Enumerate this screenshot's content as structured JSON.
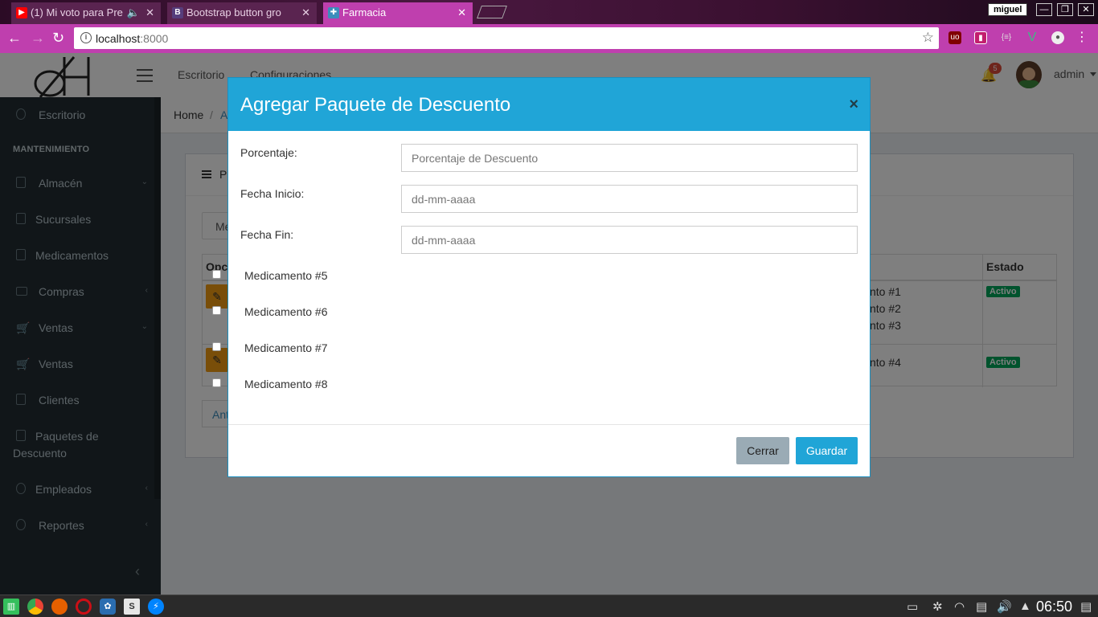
{
  "browser": {
    "tabs": [
      {
        "title": "(1) Mi voto para Pre",
        "icon": "youtube-icon",
        "color": "#ff0000"
      },
      {
        "title": "Bootstrap button gro",
        "icon": "bootstrap-icon",
        "color": "#563d7c"
      },
      {
        "title": "Farmacia",
        "icon": "farmacia-icon",
        "color": "#3c8dbc"
      }
    ],
    "user": "miguel",
    "url_host": "localhost",
    "url_port": ":8000"
  },
  "header": {
    "nav": [
      "Escritorio",
      "Configuraciones"
    ],
    "notification_count": "5",
    "username": "admin"
  },
  "sidebar": {
    "items": [
      {
        "label": "Escritorio"
      },
      {
        "label": "Almacén",
        "chevron": "⌄"
      },
      {
        "label": "Sucursales"
      },
      {
        "label": "Medicamentos"
      },
      {
        "label": "Compras",
        "chevron": "‹"
      },
      {
        "label": "Ventas",
        "chevron": "⌄"
      },
      {
        "label": "Ventas"
      },
      {
        "label": "Clientes"
      },
      {
        "label": "Paquetes de",
        "label2": "Descuento"
      },
      {
        "label": "Empleados",
        "chevron": "‹"
      },
      {
        "label": "Reportes",
        "chevron": "‹"
      }
    ],
    "section_header": "MANTENIMIENTO"
  },
  "content": {
    "breadcrumb": {
      "home": "Home",
      "sep": "/",
      "current": "A"
    },
    "box_title": "P",
    "tab_button": "Me",
    "table": {
      "headers": {
        "first": "Opc",
        "estado": "Estado"
      },
      "rows": [
        {
          "items": [
            "nto #1",
            "nto #2",
            "nto #3"
          ],
          "estado": "Activo"
        },
        {
          "items": [
            "nto #4"
          ],
          "estado": "Activo"
        }
      ]
    },
    "prev_button": "Ant"
  },
  "modal": {
    "title": "Agregar Paquete de Descuento",
    "close": "×",
    "fields": [
      {
        "label": "Porcentaje:",
        "placeholder": "Porcentaje de Descuento"
      },
      {
        "label": "Fecha Inicio:",
        "placeholder": "dd-mm-aaaa"
      },
      {
        "label": "Fecha Fin:",
        "placeholder": "dd-mm-aaaa"
      }
    ],
    "checkbox_items": [
      "Medicamento #5",
      "Medicamento #6",
      "Medicamento #7",
      "Medicamento #8"
    ],
    "buttons": {
      "cancel": "Cerrar",
      "save": "Guardar"
    }
  },
  "taskbar": {
    "clock": "06:50"
  }
}
